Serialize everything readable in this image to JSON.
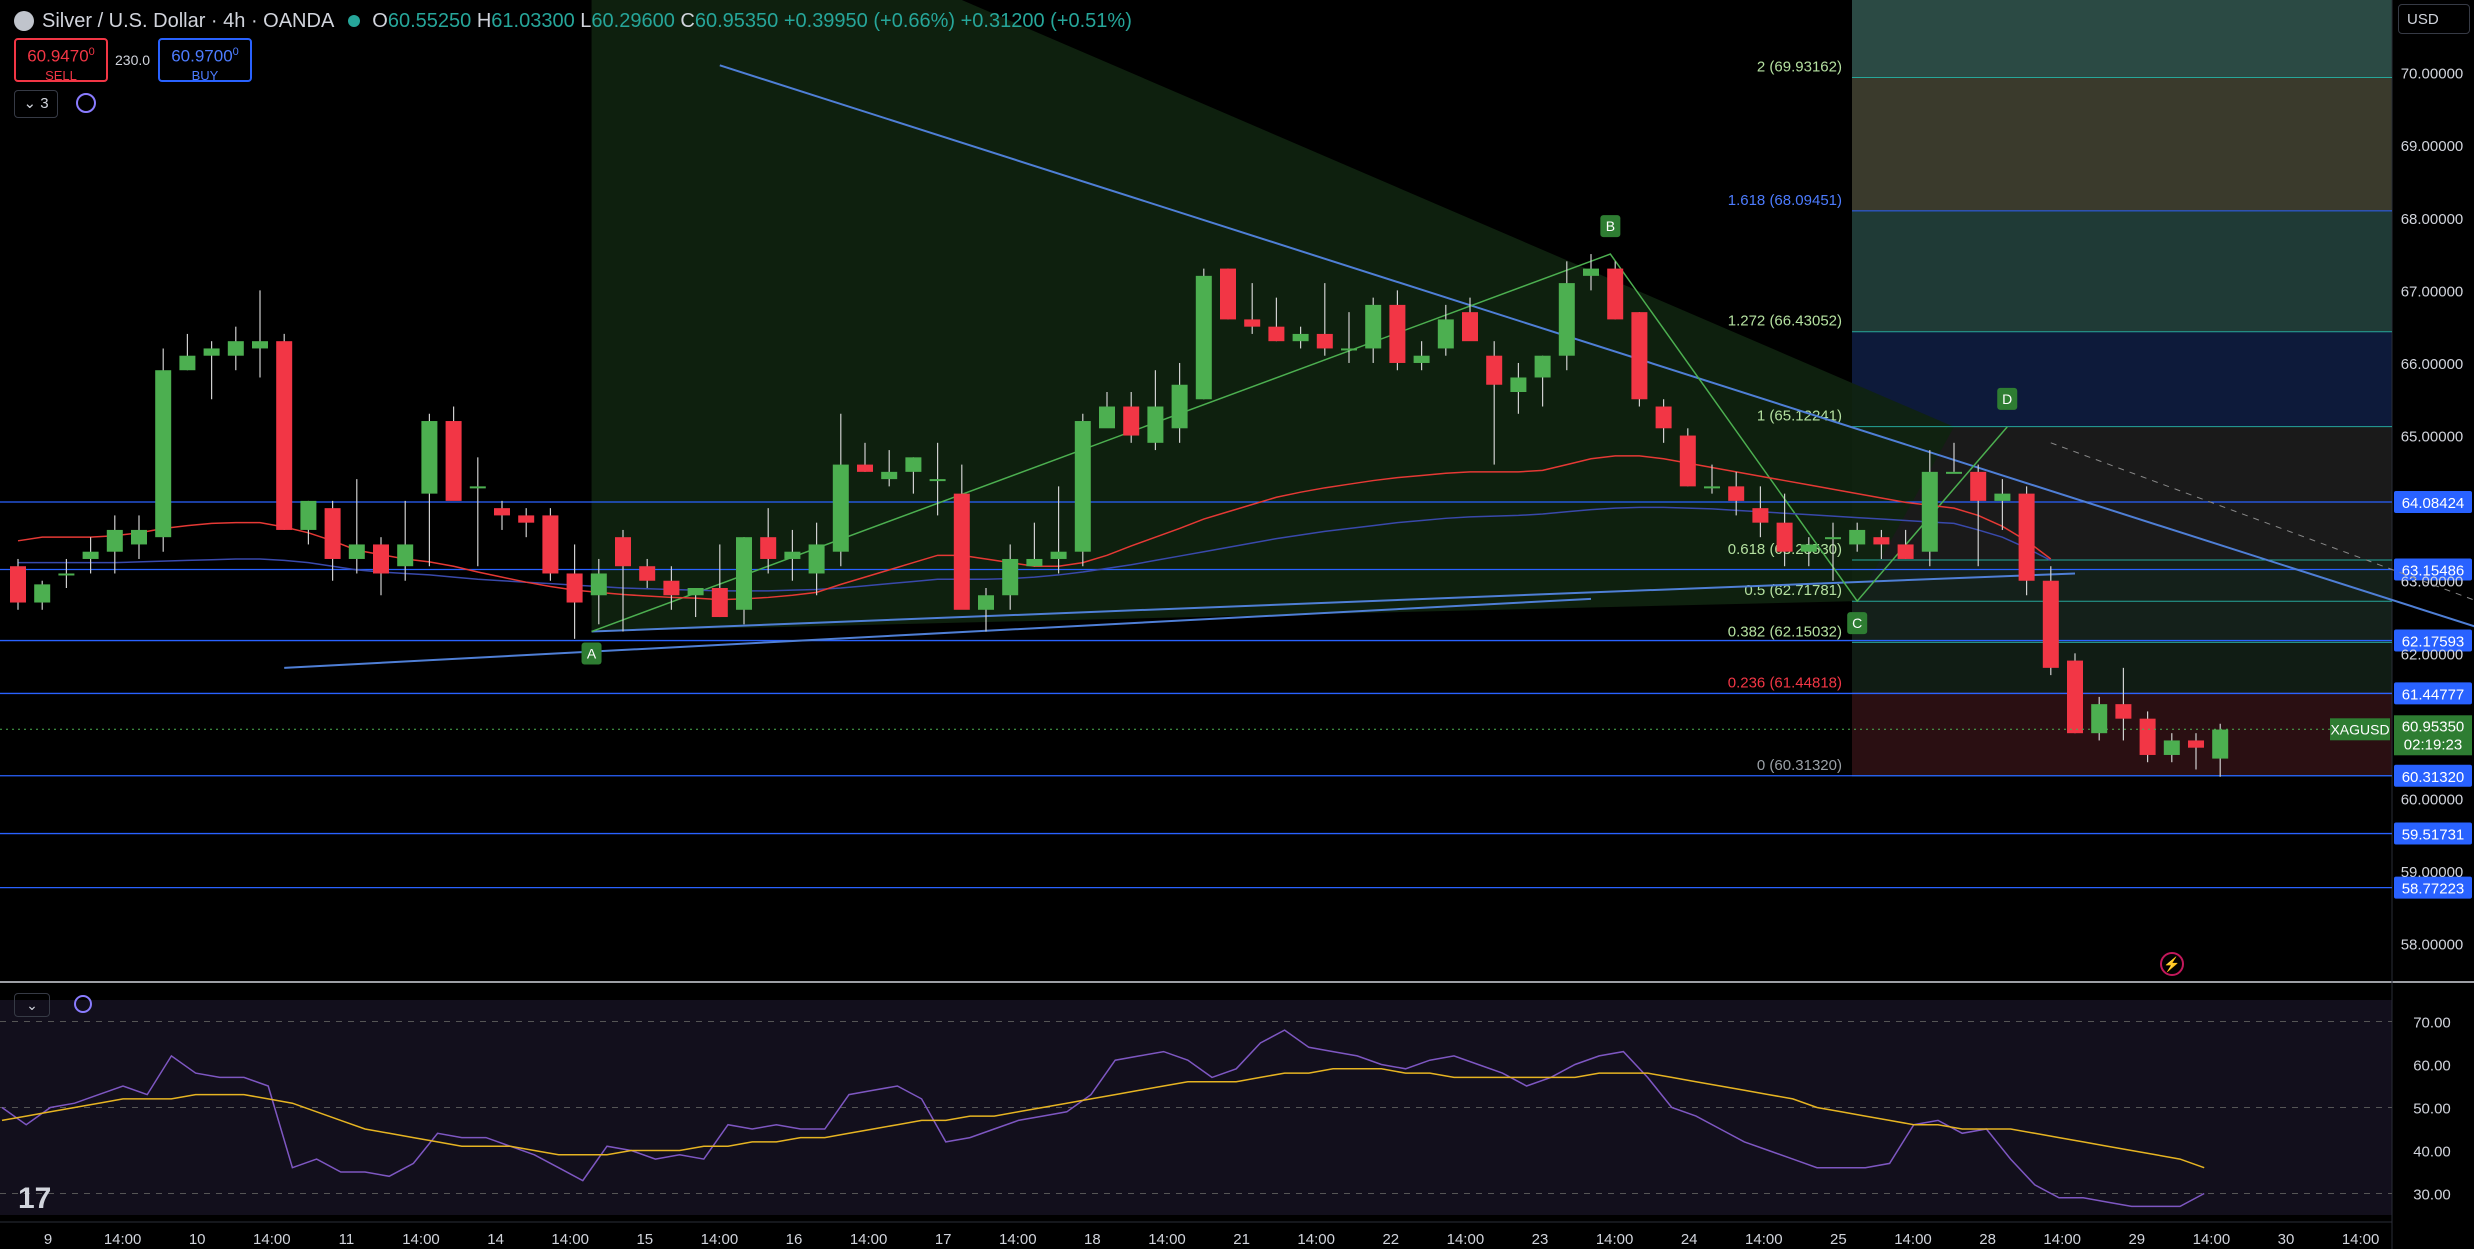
{
  "header": {
    "title": "Silver / U.S. Dollar · 4h · OANDA",
    "open_key": "O",
    "open": "60.55250",
    "high_key": "H",
    "high": "61.03300",
    "low_key": "L",
    "low": "60.29600",
    "close_key": "C",
    "close": "60.95350",
    "change": "+0.39950 (+0.66%) +0.31200 (+0.51%)"
  },
  "trade": {
    "sell_price": "60.9470",
    "sell_price_small": "0",
    "sell_label": "SELL",
    "spread": "230.0",
    "buy_price": "60.9700",
    "buy_price_small": "0",
    "buy_label": "BUY"
  },
  "toolbar": {
    "indicators_count": "⌄ 3",
    "rsi_toggle": "⌄",
    "currency": "USD"
  },
  "colors": {
    "up": "#4caf50",
    "down": "#f23645",
    "hline": "#2962ff",
    "trend": "#4f7fd6",
    "ma_red": "#e53935",
    "ma_blue": "#3949ab",
    "rsi": "#7e57c2",
    "rsi_ma": "#e6b422",
    "fib_text": "#26a69a",
    "fib_blue": "#2962ff",
    "fib_red": "#f23645"
  },
  "chart_data": [
    {
      "type": "candlestick",
      "title": "Silver / U.S. Dollar · 4h · OANDA",
      "symbol": "XAGUSD",
      "ylim": [
        57.5,
        71.0
      ],
      "y_ticks": [
        "70.00000",
        "69.00000",
        "68.00000",
        "67.00000",
        "66.00000",
        "65.00000",
        "63.00000",
        "62.00000",
        "60.00000",
        "59.00000",
        "58.00000"
      ],
      "x_ticks": [
        "9",
        "14:00",
        "10",
        "14:00",
        "11",
        "14:00",
        "14",
        "14:00",
        "15",
        "14:00",
        "16",
        "14:00",
        "17",
        "14:00",
        "18",
        "14:00",
        "21",
        "14:00",
        "22",
        "14:00",
        "23",
        "14:00",
        "24",
        "14:00",
        "25",
        "14:00",
        "28",
        "14:00",
        "29",
        "14:00",
        "30",
        "14:00"
      ],
      "candles": [
        [
          63.2,
          63.3,
          62.6,
          62.7
        ],
        [
          62.7,
          63.0,
          62.6,
          62.95
        ],
        [
          63.1,
          63.3,
          62.9,
          63.1
        ],
        [
          63.3,
          63.6,
          63.1,
          63.4
        ],
        [
          63.4,
          63.9,
          63.1,
          63.7
        ],
        [
          63.5,
          63.9,
          63.3,
          63.7
        ],
        [
          63.6,
          66.2,
          63.4,
          65.9
        ],
        [
          65.9,
          66.4,
          65.9,
          66.1
        ],
        [
          66.1,
          66.3,
          65.5,
          66.2
        ],
        [
          66.1,
          66.5,
          65.9,
          66.3
        ],
        [
          66.2,
          67.0,
          65.8,
          66.3
        ],
        [
          66.3,
          66.4,
          63.7,
          63.7
        ],
        [
          63.7,
          64.1,
          63.5,
          64.1
        ],
        [
          64.0,
          64.1,
          63.0,
          63.3
        ],
        [
          63.3,
          64.4,
          63.1,
          63.5
        ],
        [
          63.5,
          63.6,
          62.8,
          63.1
        ],
        [
          63.2,
          64.1,
          63.0,
          63.5
        ],
        [
          64.2,
          65.3,
          63.2,
          65.2
        ],
        [
          65.2,
          65.4,
          64.2,
          64.1
        ],
        [
          64.3,
          64.7,
          63.2,
          64.3
        ],
        [
          64.0,
          64.1,
          63.7,
          63.9
        ],
        [
          63.9,
          64.0,
          63.6,
          63.8
        ],
        [
          63.9,
          64.0,
          63.0,
          63.1
        ],
        [
          63.1,
          63.5,
          62.2,
          62.7
        ],
        [
          62.8,
          63.3,
          62.4,
          63.1
        ],
        [
          63.6,
          63.7,
          62.3,
          63.2
        ],
        [
          63.2,
          63.3,
          62.9,
          63.0
        ],
        [
          63.0,
          63.2,
          62.6,
          62.8
        ],
        [
          62.8,
          62.9,
          62.5,
          62.9
        ],
        [
          62.9,
          63.5,
          62.5,
          62.5
        ],
        [
          62.6,
          63.6,
          62.4,
          63.6
        ],
        [
          63.6,
          64.0,
          63.1,
          63.3
        ],
        [
          63.3,
          63.7,
          63.0,
          63.4
        ],
        [
          63.1,
          63.8,
          62.8,
          63.5
        ],
        [
          63.4,
          65.3,
          63.2,
          64.6
        ],
        [
          64.6,
          64.9,
          64.5,
          64.5
        ],
        [
          64.4,
          64.8,
          64.3,
          64.5
        ],
        [
          64.5,
          64.7,
          64.2,
          64.7
        ],
        [
          64.4,
          64.9,
          63.9,
          64.4
        ],
        [
          64.2,
          64.6,
          63.8,
          62.6
        ],
        [
          62.6,
          62.9,
          62.3,
          62.8
        ],
        [
          62.8,
          63.5,
          62.6,
          63.3
        ],
        [
          63.2,
          63.8,
          63.2,
          63.3
        ],
        [
          63.3,
          64.3,
          63.1,
          63.4
        ],
        [
          63.4,
          65.3,
          63.2,
          65.2
        ],
        [
          65.1,
          65.6,
          65.2,
          65.4
        ],
        [
          65.4,
          65.6,
          64.9,
          65.0
        ],
        [
          64.9,
          65.9,
          64.8,
          65.4
        ],
        [
          65.1,
          66.0,
          64.9,
          65.7
        ],
        [
          65.5,
          67.3,
          65.5,
          67.2
        ],
        [
          67.3,
          67.3,
          66.6,
          66.6
        ],
        [
          66.6,
          67.1,
          66.4,
          66.5
        ],
        [
          66.5,
          66.9,
          66.3,
          66.3
        ],
        [
          66.3,
          66.5,
          66.2,
          66.4
        ],
        [
          66.4,
          67.1,
          66.1,
          66.2
        ],
        [
          66.2,
          66.7,
          66.0,
          66.2
        ],
        [
          66.2,
          66.9,
          66.0,
          66.8
        ],
        [
          66.8,
          67.0,
          65.9,
          66.0
        ],
        [
          66.0,
          66.3,
          65.9,
          66.1
        ],
        [
          66.2,
          66.8,
          66.1,
          66.6
        ],
        [
          66.7,
          66.9,
          66.4,
          66.3
        ],
        [
          66.1,
          66.3,
          64.6,
          65.7
        ],
        [
          65.6,
          66.0,
          65.3,
          65.8
        ],
        [
          65.8,
          66.1,
          65.4,
          66.1
        ],
        [
          66.1,
          67.4,
          65.9,
          67.1
        ],
        [
          67.2,
          67.5,
          67.0,
          67.3
        ],
        [
          67.3,
          67.4,
          66.6,
          66.6
        ],
        [
          66.7,
          66.7,
          65.4,
          65.5
        ],
        [
          65.4,
          65.5,
          64.9,
          65.1
        ],
        [
          65.0,
          65.1,
          64.3,
          64.3
        ],
        [
          64.3,
          64.6,
          64.2,
          64.3
        ],
        [
          64.3,
          64.5,
          63.9,
          64.1
        ],
        [
          64.0,
          64.3,
          63.6,
          63.8
        ],
        [
          63.8,
          64.2,
          63.2,
          63.4
        ],
        [
          63.4,
          63.6,
          63.2,
          63.5
        ],
        [
          63.6,
          63.8,
          63.0,
          63.6
        ],
        [
          63.5,
          63.8,
          63.4,
          63.7
        ],
        [
          63.6,
          63.7,
          63.3,
          63.5
        ],
        [
          63.5,
          63.7,
          63.3,
          63.3
        ],
        [
          63.4,
          64.8,
          63.2,
          64.5
        ],
        [
          64.5,
          64.9,
          64.5,
          64.5
        ],
        [
          64.5,
          64.6,
          63.2,
          64.1
        ],
        [
          64.1,
          64.4,
          63.7,
          64.2
        ],
        [
          64.2,
          64.3,
          62.8,
          63.0
        ],
        [
          63.0,
          63.2,
          61.7,
          61.8
        ],
        [
          61.9,
          62.0,
          60.9,
          60.9
        ],
        [
          60.9,
          61.4,
          60.8,
          61.3
        ],
        [
          61.3,
          61.8,
          60.8,
          61.1
        ],
        [
          61.1,
          61.2,
          60.5,
          60.6
        ],
        [
          60.6,
          60.9,
          60.5,
          60.8
        ],
        [
          60.8,
          60.9,
          60.4,
          60.7
        ],
        [
          60.55,
          61.03,
          60.3,
          60.95
        ]
      ],
      "horizontal_levels": [
        "64.08424",
        "63.15486",
        "62.17593",
        "61.44777",
        "60.31320",
        "59.51731",
        "58.77223"
      ],
      "current_price": {
        "symbol": "XAGUSD",
        "value": "60.95350",
        "countdown": "02:19:23"
      },
      "pattern_points": [
        "A",
        "B",
        "C",
        "D"
      ],
      "fib_levels": [
        {
          "ratio": "2",
          "value": "69.93162",
          "label": "2 (69.93162)"
        },
        {
          "ratio": "1.618",
          "value": "68.09451",
          "label": "1.618 (68.09451)"
        },
        {
          "ratio": "1.272",
          "value": "66.43052",
          "label": "1.272 (66.43052)"
        },
        {
          "ratio": "1",
          "value": "65.12241",
          "label": "1 (65.12241)"
        },
        {
          "ratio": "0.618",
          "value": "63.28530",
          "label": "0.618 (63.28530)"
        },
        {
          "ratio": "0.5",
          "value": "62.71781",
          "label": "0.5 (62.71781)"
        },
        {
          "ratio": "0.382",
          "value": "62.15032",
          "label": "0.382 (62.15032)"
        },
        {
          "ratio": "0.236",
          "value": "61.44818",
          "label": "0.236 (61.44818)"
        },
        {
          "ratio": "0",
          "value": "60.31320",
          "label": "0 (60.31320)"
        }
      ],
      "ma_red": [
        63.55,
        63.6,
        63.6,
        63.6,
        63.62,
        63.66,
        63.72,
        63.76,
        63.79,
        63.8,
        63.8,
        63.74,
        63.66,
        63.55,
        63.42,
        63.36,
        63.3,
        63.26,
        63.2,
        63.12,
        63.05,
        62.98,
        62.92,
        62.87,
        62.84,
        62.81,
        62.79,
        62.77,
        62.76,
        62.74,
        62.75,
        62.77,
        62.8,
        62.84,
        62.95,
        63.05,
        63.15,
        63.25,
        63.35,
        63.35,
        63.3,
        63.25,
        63.2,
        63.2,
        63.25,
        63.35,
        63.48,
        63.6,
        63.72,
        63.85,
        63.95,
        64.05,
        64.15,
        64.22,
        64.28,
        64.33,
        64.38,
        64.42,
        64.45,
        64.48,
        64.5,
        64.5,
        64.5,
        64.52,
        64.6,
        64.68,
        64.72,
        64.72,
        64.68,
        64.62,
        64.56,
        64.5,
        64.44,
        64.38,
        64.32,
        64.26,
        64.2,
        64.14,
        64.08,
        64.04,
        64.0,
        63.9,
        63.75,
        63.55,
        63.3
      ],
      "ma_blue": [
        63.25,
        63.25,
        63.25,
        63.25,
        63.25,
        63.26,
        63.27,
        63.28,
        63.29,
        63.3,
        63.3,
        63.28,
        63.25,
        63.2,
        63.15,
        63.12,
        63.1,
        63.08,
        63.05,
        63.02,
        63.0,
        62.98,
        62.96,
        62.94,
        62.92,
        62.9,
        62.89,
        62.88,
        62.87,
        62.86,
        62.86,
        62.86,
        62.87,
        62.88,
        62.9,
        62.93,
        62.96,
        62.99,
        63.02,
        63.02,
        63.02,
        63.03,
        63.05,
        63.08,
        63.12,
        63.17,
        63.22,
        63.28,
        63.34,
        63.4,
        63.46,
        63.52,
        63.58,
        63.63,
        63.68,
        63.72,
        63.76,
        63.8,
        63.83,
        63.86,
        63.88,
        63.89,
        63.9,
        63.92,
        63.95,
        63.98,
        64.0,
        64.01,
        64.01,
        64.0,
        63.99,
        63.97,
        63.95,
        63.93,
        63.91,
        63.89,
        63.87,
        63.85,
        63.83,
        63.81,
        63.79,
        63.7,
        63.6,
        63.45,
        63.28
      ]
    },
    {
      "type": "line",
      "indicator": "RSI",
      "ylim": [
        25,
        75
      ],
      "y_ticks": [
        "70.00",
        "60.00",
        "50.00",
        "40.00",
        "30.00"
      ],
      "series": [
        {
          "values": [
            50,
            46,
            50,
            51,
            53,
            55,
            53,
            62,
            58,
            57,
            57,
            55,
            36,
            38,
            35,
            35,
            34,
            37,
            44,
            43,
            43,
            41,
            39,
            36,
            33,
            41,
            40,
            38,
            39,
            38,
            46,
            45,
            46,
            45,
            45,
            53,
            54,
            55,
            52,
            42,
            43,
            45,
            47,
            48,
            49,
            53,
            61,
            62,
            63,
            61,
            57,
            59,
            65,
            68,
            64,
            63,
            62,
            60,
            59,
            61,
            62,
            60,
            58,
            55,
            57,
            60,
            62,
            63,
            57,
            50,
            48,
            45,
            42,
            40,
            38,
            36,
            36,
            36,
            37,
            46,
            47,
            44,
            45,
            38,
            32,
            29,
            29,
            28,
            27,
            27,
            27,
            30
          ]
        },
        {
          "values": [
            47,
            48,
            49,
            50,
            51,
            52,
            52,
            52,
            53,
            53,
            53,
            52,
            51,
            49,
            47,
            45,
            44,
            43,
            42,
            41,
            41,
            41,
            40,
            39,
            39,
            39,
            40,
            40,
            40,
            41,
            41,
            42,
            42,
            43,
            43,
            44,
            45,
            46,
            47,
            47,
            48,
            48,
            49,
            50,
            51,
            52,
            53,
            54,
            55,
            56,
            56,
            56,
            57,
            58,
            58,
            59,
            59,
            59,
            58,
            58,
            57,
            57,
            57,
            57,
            57,
            57,
            58,
            58,
            58,
            57,
            56,
            55,
            54,
            53,
            52,
            50,
            49,
            48,
            47,
            46,
            46,
            45,
            45,
            45,
            44,
            43,
            42,
            41,
            40,
            39,
            38,
            36
          ]
        }
      ]
    }
  ]
}
